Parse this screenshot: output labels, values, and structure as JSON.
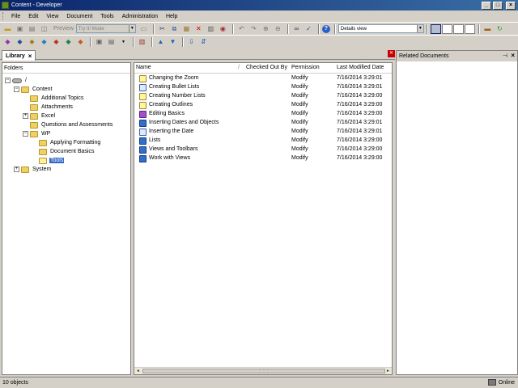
{
  "window": {
    "title": "Content - Developer"
  },
  "menu": [
    "File",
    "Edit",
    "View",
    "Document",
    "Tools",
    "Administration",
    "Help"
  ],
  "toolbar": {
    "preview_label": "Preview",
    "mode_value": "Try It! Mode",
    "view_value": "Details view"
  },
  "tabs": {
    "library_label": "Library"
  },
  "folders": {
    "header": "Folders",
    "tree": [
      {
        "label": "/",
        "depth": 0,
        "expander": "−",
        "type": "drive"
      },
      {
        "label": "Content",
        "depth": 1,
        "expander": "−",
        "type": "folder"
      },
      {
        "label": "Additional Topics",
        "depth": 2,
        "expander": "",
        "type": "folder"
      },
      {
        "label": "Attachments",
        "depth": 2,
        "expander": "",
        "type": "folder"
      },
      {
        "label": "Excel",
        "depth": 2,
        "expander": "+",
        "type": "folder"
      },
      {
        "label": "Questions and Assessments",
        "depth": 2,
        "expander": "",
        "type": "folder"
      },
      {
        "label": "WP",
        "depth": 2,
        "expander": "−",
        "type": "folder"
      },
      {
        "label": "Applying Formatting",
        "depth": 3,
        "expander": "",
        "type": "folder"
      },
      {
        "label": "Document Basics",
        "depth": 3,
        "expander": "",
        "type": "folder"
      },
      {
        "label": "Tools",
        "depth": 3,
        "expander": "",
        "type": "folder",
        "selected": true
      },
      {
        "label": "System",
        "depth": 1,
        "expander": "+",
        "type": "folder"
      }
    ]
  },
  "documents": {
    "columns": {
      "name": "Name",
      "sort_marker": "/",
      "checked_out_by": "Checked Out By",
      "permission": "Permission",
      "last_modified": "Last Modified Date"
    },
    "rows": [
      {
        "name": "Changing the Zoom",
        "permission": "Modify",
        "modified": "7/16/2014 3:29:01",
        "icon": "topic-bulb-icon"
      },
      {
        "name": "Creating Bullet Lists",
        "permission": "Modify",
        "modified": "7/16/2014 3:29:01",
        "icon": "topic-frame-icon"
      },
      {
        "name": "Creating Number Lists",
        "permission": "Modify",
        "modified": "7/16/2014 3:29:00",
        "icon": "topic-bulb-icon"
      },
      {
        "name": "Creating Outlines",
        "permission": "Modify",
        "modified": "7/16/2014 3:29:00",
        "icon": "topic-bulb-icon"
      },
      {
        "name": "Editing Basics",
        "permission": "Modify",
        "modified": "7/16/2014 3:29:00",
        "icon": "module-purple-icon"
      },
      {
        "name": "Inserting Dates and Objects",
        "permission": "Modify",
        "modified": "7/16/2014 3:29:01",
        "icon": "book-icon"
      },
      {
        "name": "Inserting the Date",
        "permission": "Modify",
        "modified": "7/16/2014 3:29:01",
        "icon": "topic-frame-icon"
      },
      {
        "name": "Lists",
        "permission": "Modify",
        "modified": "7/16/2014 3:29:00",
        "icon": "book-icon"
      },
      {
        "name": "Views and Toolbars",
        "permission": "Modify",
        "modified": "7/16/2014 3:29:00",
        "icon": "book-icon"
      },
      {
        "name": "Work with Views",
        "permission": "Modify",
        "modified": "7/16/2014 3:29:00",
        "icon": "book-icon"
      }
    ]
  },
  "related": {
    "title": "Related Documents"
  },
  "status": {
    "count": "10 objects",
    "connection": "Online"
  },
  "colors": {
    "titlebar": "#0a246a",
    "selection": "#3169c6",
    "folder": "#f0d060"
  }
}
